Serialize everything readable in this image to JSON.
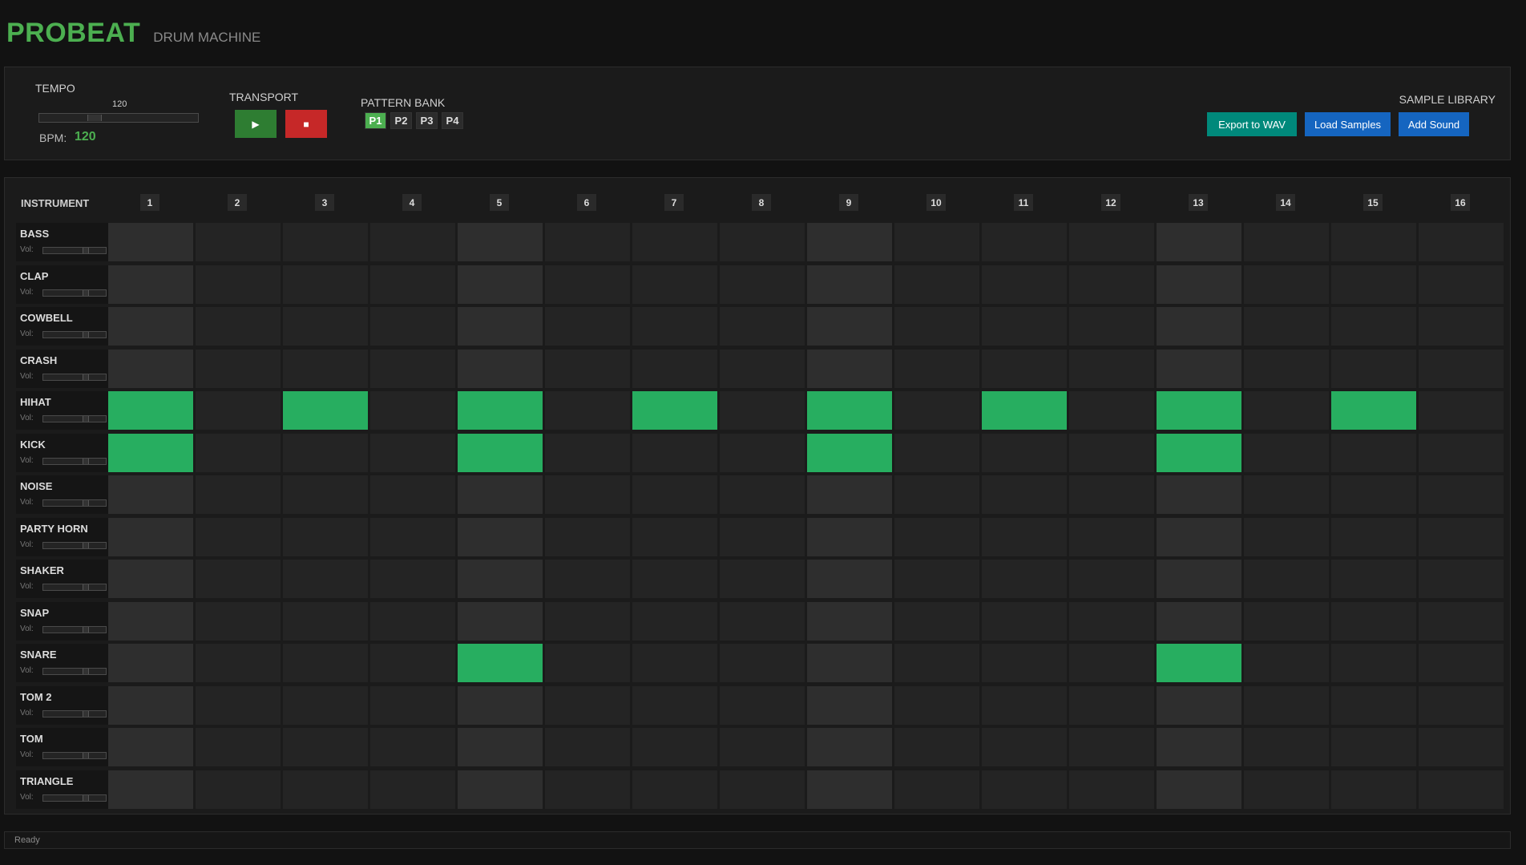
{
  "app": {
    "title": "PROBEAT",
    "subtitle": "DRUM MACHINE"
  },
  "tempo": {
    "label": "TEMPO",
    "value_label": "120",
    "bpm_label": "BPM:",
    "bpm_value": "120",
    "bpm": 120,
    "range": [
      60,
      240
    ]
  },
  "transport": {
    "label": "TRANSPORT",
    "play_icon": "▶",
    "stop_icon": "■"
  },
  "pattern_bank": {
    "label": "PATTERN BANK",
    "patterns": [
      "P1",
      "P2",
      "P3",
      "P4"
    ],
    "active": "P1"
  },
  "sample_library": {
    "label": "SAMPLE LIBRARY",
    "buttons": [
      "Export to WAV",
      "Load Samples",
      "Add Sound"
    ]
  },
  "grid": {
    "instrument_header": "INSTRUMENT",
    "steps": [
      "1",
      "2",
      "3",
      "4",
      "5",
      "6",
      "7",
      "8",
      "9",
      "10",
      "11",
      "12",
      "13",
      "14",
      "15",
      "16"
    ],
    "volume_label": "Vol:",
    "instruments": [
      {
        "name": "BASS",
        "volume": 0.7,
        "active_steps": []
      },
      {
        "name": "CLAP",
        "volume": 0.7,
        "active_steps": []
      },
      {
        "name": "COWBELL",
        "volume": 0.7,
        "active_steps": []
      },
      {
        "name": "CRASH",
        "volume": 0.7,
        "active_steps": []
      },
      {
        "name": "HIHAT",
        "volume": 0.7,
        "active_steps": [
          1,
          3,
          5,
          7,
          9,
          11,
          13,
          15
        ]
      },
      {
        "name": "KICK",
        "volume": 0.7,
        "active_steps": [
          1,
          5,
          9,
          13
        ]
      },
      {
        "name": "NOISE",
        "volume": 0.7,
        "active_steps": []
      },
      {
        "name": "PARTY HORN",
        "volume": 0.7,
        "active_steps": []
      },
      {
        "name": "SHAKER",
        "volume": 0.7,
        "active_steps": []
      },
      {
        "name": "SNAP",
        "volume": 0.7,
        "active_steps": []
      },
      {
        "name": "SNARE",
        "volume": 0.7,
        "active_steps": [
          5,
          13
        ]
      },
      {
        "name": "TOM 2",
        "volume": 0.7,
        "active_steps": []
      },
      {
        "name": "TOM",
        "volume": 0.7,
        "active_steps": []
      },
      {
        "name": "TRIANGLE",
        "volume": 0.7,
        "active_steps": []
      }
    ]
  },
  "status": {
    "text": "Ready"
  },
  "colors": {
    "accent": "#4caf50",
    "step_on": "#27ae60",
    "play": "#2e7d32",
    "stop": "#c62828",
    "export": "#00897b",
    "blue": "#1565c0"
  }
}
